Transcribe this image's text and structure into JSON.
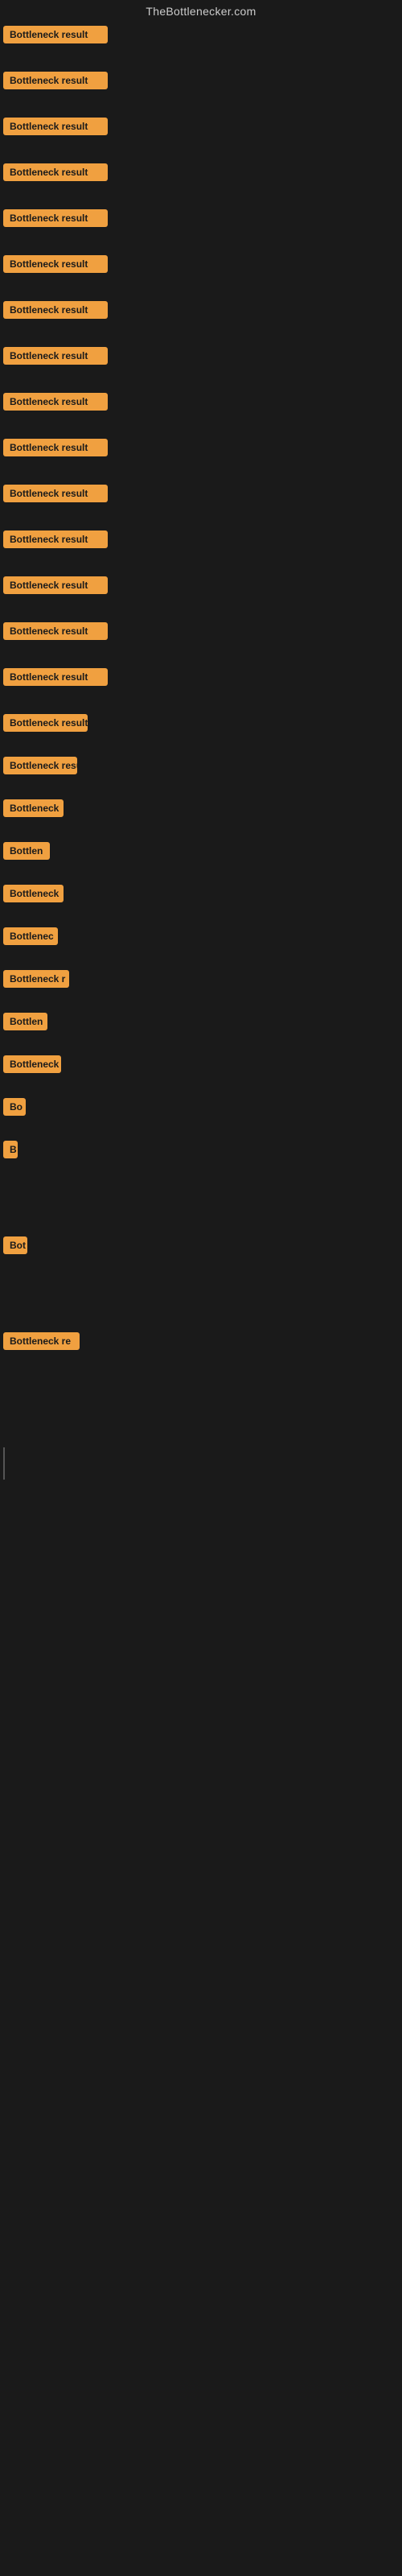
{
  "site": {
    "title": "TheBottlenecker.com"
  },
  "items": [
    {
      "id": 1,
      "label": "Bottleneck result",
      "width": 130,
      "gap_after": 18
    },
    {
      "id": 2,
      "label": "Bottleneck result",
      "width": 130,
      "gap_after": 18
    },
    {
      "id": 3,
      "label": "Bottleneck result",
      "width": 130,
      "gap_after": 18
    },
    {
      "id": 4,
      "label": "Bottleneck result",
      "width": 130,
      "gap_after": 18
    },
    {
      "id": 5,
      "label": "Bottleneck result",
      "width": 130,
      "gap_after": 18
    },
    {
      "id": 6,
      "label": "Bottleneck result",
      "width": 130,
      "gap_after": 18
    },
    {
      "id": 7,
      "label": "Bottleneck result",
      "width": 130,
      "gap_after": 18
    },
    {
      "id": 8,
      "label": "Bottleneck result",
      "width": 130,
      "gap_after": 18
    },
    {
      "id": 9,
      "label": "Bottleneck result",
      "width": 130,
      "gap_after": 18
    },
    {
      "id": 10,
      "label": "Bottleneck result",
      "width": 130,
      "gap_after": 18
    },
    {
      "id": 11,
      "label": "Bottleneck result",
      "width": 130,
      "gap_after": 18
    },
    {
      "id": 12,
      "label": "Bottleneck result",
      "width": 130,
      "gap_after": 18
    },
    {
      "id": 13,
      "label": "Bottleneck result",
      "width": 130,
      "gap_after": 18
    },
    {
      "id": 14,
      "label": "Bottleneck result",
      "width": 130,
      "gap_after": 18
    },
    {
      "id": 15,
      "label": "Bottleneck result",
      "width": 130,
      "gap_after": 18
    },
    {
      "id": 16,
      "label": "Bottleneck result",
      "width": 105,
      "gap_after": 14
    },
    {
      "id": 17,
      "label": "Bottleneck resu",
      "width": 92,
      "gap_after": 14
    },
    {
      "id": 18,
      "label": "Bottleneck",
      "width": 75,
      "gap_after": 14
    },
    {
      "id": 19,
      "label": "Bottlen",
      "width": 58,
      "gap_after": 14
    },
    {
      "id": 20,
      "label": "Bottleneck",
      "width": 75,
      "gap_after": 14
    },
    {
      "id": 21,
      "label": "Bottlenec",
      "width": 68,
      "gap_after": 14
    },
    {
      "id": 22,
      "label": "Bottleneck r",
      "width": 82,
      "gap_after": 14
    },
    {
      "id": 23,
      "label": "Bottlen",
      "width": 55,
      "gap_after": 14
    },
    {
      "id": 24,
      "label": "Bottleneck",
      "width": 72,
      "gap_after": 14
    },
    {
      "id": 25,
      "label": "Bo",
      "width": 28,
      "gap_after": 14
    },
    {
      "id": 26,
      "label": "B",
      "width": 18,
      "gap_after": 30
    },
    {
      "id": 27,
      "label": "",
      "width": 0,
      "gap_after": 50
    },
    {
      "id": 28,
      "label": "Bot",
      "width": 30,
      "gap_after": 80
    },
    {
      "id": 29,
      "label": "Bottleneck re",
      "width": 95,
      "gap_after": 80
    }
  ]
}
